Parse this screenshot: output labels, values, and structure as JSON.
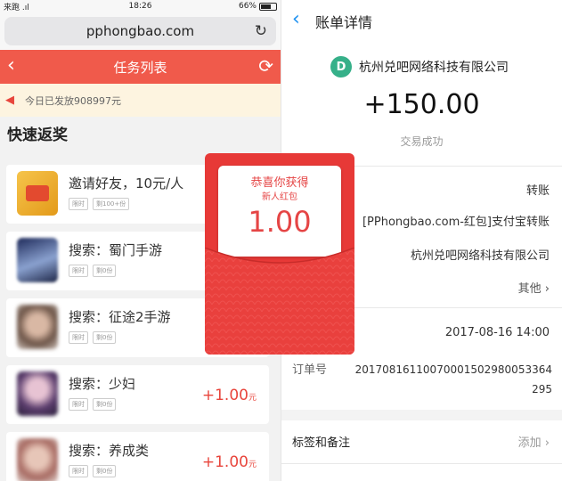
{
  "left": {
    "status": {
      "carrier": "来跑 .ıl",
      "time": "18:26",
      "battery": "66%"
    },
    "url": "pphongbao.com",
    "navbar": {
      "title": "任务列表"
    },
    "notice": "今日已发放908997元",
    "section_title": "快速返奖",
    "cards": [
      {
        "title": "邀请好友，10元/人",
        "tag1": "限时",
        "tag2": "剩100+份",
        "reward": "",
        "unit": ""
      },
      {
        "title": "搜索：蜀门手游",
        "tag1": "限时",
        "tag2": "剩0份",
        "reward": "",
        "unit": ""
      },
      {
        "title": "搜索：征途2手游",
        "tag1": "限时",
        "tag2": "剩0份",
        "reward": "",
        "unit": ""
      },
      {
        "title": "搜索：少妇",
        "tag1": "限时",
        "tag2": "剩0份",
        "reward": "+1.00",
        "unit": "元"
      },
      {
        "title": "搜索：养成类",
        "tag1": "限时",
        "tag2": "剩0份",
        "reward": "+1.00",
        "unit": "元"
      }
    ]
  },
  "envelope": {
    "line1": "恭喜你获得",
    "line2": "新人红包",
    "amount": "1.00"
  },
  "right": {
    "title": "账单详情",
    "company": "杭州兑吧网络科技有限公司",
    "logo_letter": "D",
    "amount": "+150.00",
    "status": "交易成功",
    "type": "转账",
    "description": "[PPhongbao.com-红包]支付宝转账",
    "counterparty": "杭州兑吧网络科技有限公司",
    "other": "其他 ›",
    "date": "2017-08-16 14:00",
    "order_label": "订单号",
    "order_number": "20170816110070001502980053364295",
    "tags_label": "标签和备注",
    "tags_action": "添加 ›"
  }
}
